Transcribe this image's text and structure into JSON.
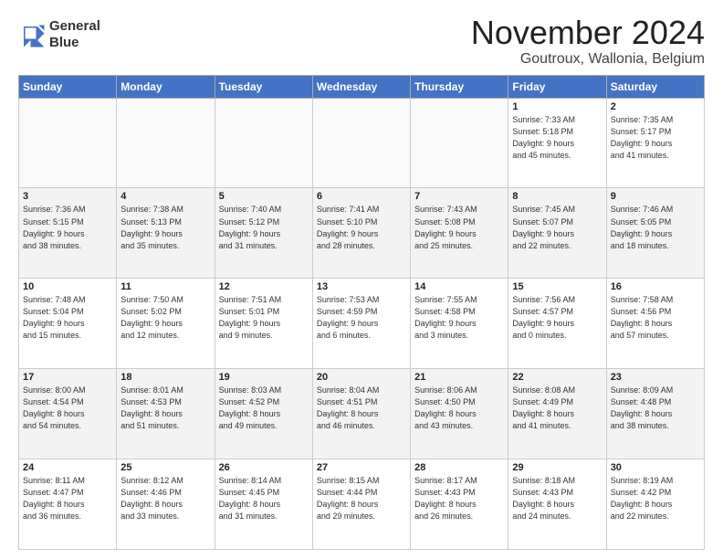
{
  "logo": {
    "line1": "General",
    "line2": "Blue"
  },
  "title": "November 2024",
  "subtitle": "Goutroux, Wallonia, Belgium",
  "headers": [
    "Sunday",
    "Monday",
    "Tuesday",
    "Wednesday",
    "Thursday",
    "Friday",
    "Saturday"
  ],
  "weeks": [
    [
      {
        "day": "",
        "info": ""
      },
      {
        "day": "",
        "info": ""
      },
      {
        "day": "",
        "info": ""
      },
      {
        "day": "",
        "info": ""
      },
      {
        "day": "",
        "info": ""
      },
      {
        "day": "1",
        "info": "Sunrise: 7:33 AM\nSunset: 5:18 PM\nDaylight: 9 hours\nand 45 minutes."
      },
      {
        "day": "2",
        "info": "Sunrise: 7:35 AM\nSunset: 5:17 PM\nDaylight: 9 hours\nand 41 minutes."
      }
    ],
    [
      {
        "day": "3",
        "info": "Sunrise: 7:36 AM\nSunset: 5:15 PM\nDaylight: 9 hours\nand 38 minutes."
      },
      {
        "day": "4",
        "info": "Sunrise: 7:38 AM\nSunset: 5:13 PM\nDaylight: 9 hours\nand 35 minutes."
      },
      {
        "day": "5",
        "info": "Sunrise: 7:40 AM\nSunset: 5:12 PM\nDaylight: 9 hours\nand 31 minutes."
      },
      {
        "day": "6",
        "info": "Sunrise: 7:41 AM\nSunset: 5:10 PM\nDaylight: 9 hours\nand 28 minutes."
      },
      {
        "day": "7",
        "info": "Sunrise: 7:43 AM\nSunset: 5:08 PM\nDaylight: 9 hours\nand 25 minutes."
      },
      {
        "day": "8",
        "info": "Sunrise: 7:45 AM\nSunset: 5:07 PM\nDaylight: 9 hours\nand 22 minutes."
      },
      {
        "day": "9",
        "info": "Sunrise: 7:46 AM\nSunset: 5:05 PM\nDaylight: 9 hours\nand 18 minutes."
      }
    ],
    [
      {
        "day": "10",
        "info": "Sunrise: 7:48 AM\nSunset: 5:04 PM\nDaylight: 9 hours\nand 15 minutes."
      },
      {
        "day": "11",
        "info": "Sunrise: 7:50 AM\nSunset: 5:02 PM\nDaylight: 9 hours\nand 12 minutes."
      },
      {
        "day": "12",
        "info": "Sunrise: 7:51 AM\nSunset: 5:01 PM\nDaylight: 9 hours\nand 9 minutes."
      },
      {
        "day": "13",
        "info": "Sunrise: 7:53 AM\nSunset: 4:59 PM\nDaylight: 9 hours\nand 6 minutes."
      },
      {
        "day": "14",
        "info": "Sunrise: 7:55 AM\nSunset: 4:58 PM\nDaylight: 9 hours\nand 3 minutes."
      },
      {
        "day": "15",
        "info": "Sunrise: 7:56 AM\nSunset: 4:57 PM\nDaylight: 9 hours\nand 0 minutes."
      },
      {
        "day": "16",
        "info": "Sunrise: 7:58 AM\nSunset: 4:56 PM\nDaylight: 8 hours\nand 57 minutes."
      }
    ],
    [
      {
        "day": "17",
        "info": "Sunrise: 8:00 AM\nSunset: 4:54 PM\nDaylight: 8 hours\nand 54 minutes."
      },
      {
        "day": "18",
        "info": "Sunrise: 8:01 AM\nSunset: 4:53 PM\nDaylight: 8 hours\nand 51 minutes."
      },
      {
        "day": "19",
        "info": "Sunrise: 8:03 AM\nSunset: 4:52 PM\nDaylight: 8 hours\nand 49 minutes."
      },
      {
        "day": "20",
        "info": "Sunrise: 8:04 AM\nSunset: 4:51 PM\nDaylight: 8 hours\nand 46 minutes."
      },
      {
        "day": "21",
        "info": "Sunrise: 8:06 AM\nSunset: 4:50 PM\nDaylight: 8 hours\nand 43 minutes."
      },
      {
        "day": "22",
        "info": "Sunrise: 8:08 AM\nSunset: 4:49 PM\nDaylight: 8 hours\nand 41 minutes."
      },
      {
        "day": "23",
        "info": "Sunrise: 8:09 AM\nSunset: 4:48 PM\nDaylight: 8 hours\nand 38 minutes."
      }
    ],
    [
      {
        "day": "24",
        "info": "Sunrise: 8:11 AM\nSunset: 4:47 PM\nDaylight: 8 hours\nand 36 minutes."
      },
      {
        "day": "25",
        "info": "Sunrise: 8:12 AM\nSunset: 4:46 PM\nDaylight: 8 hours\nand 33 minutes."
      },
      {
        "day": "26",
        "info": "Sunrise: 8:14 AM\nSunset: 4:45 PM\nDaylight: 8 hours\nand 31 minutes."
      },
      {
        "day": "27",
        "info": "Sunrise: 8:15 AM\nSunset: 4:44 PM\nDaylight: 8 hours\nand 29 minutes."
      },
      {
        "day": "28",
        "info": "Sunrise: 8:17 AM\nSunset: 4:43 PM\nDaylight: 8 hours\nand 26 minutes."
      },
      {
        "day": "29",
        "info": "Sunrise: 8:18 AM\nSunset: 4:43 PM\nDaylight: 8 hours\nand 24 minutes."
      },
      {
        "day": "30",
        "info": "Sunrise: 8:19 AM\nSunset: 4:42 PM\nDaylight: 8 hours\nand 22 minutes."
      }
    ]
  ]
}
